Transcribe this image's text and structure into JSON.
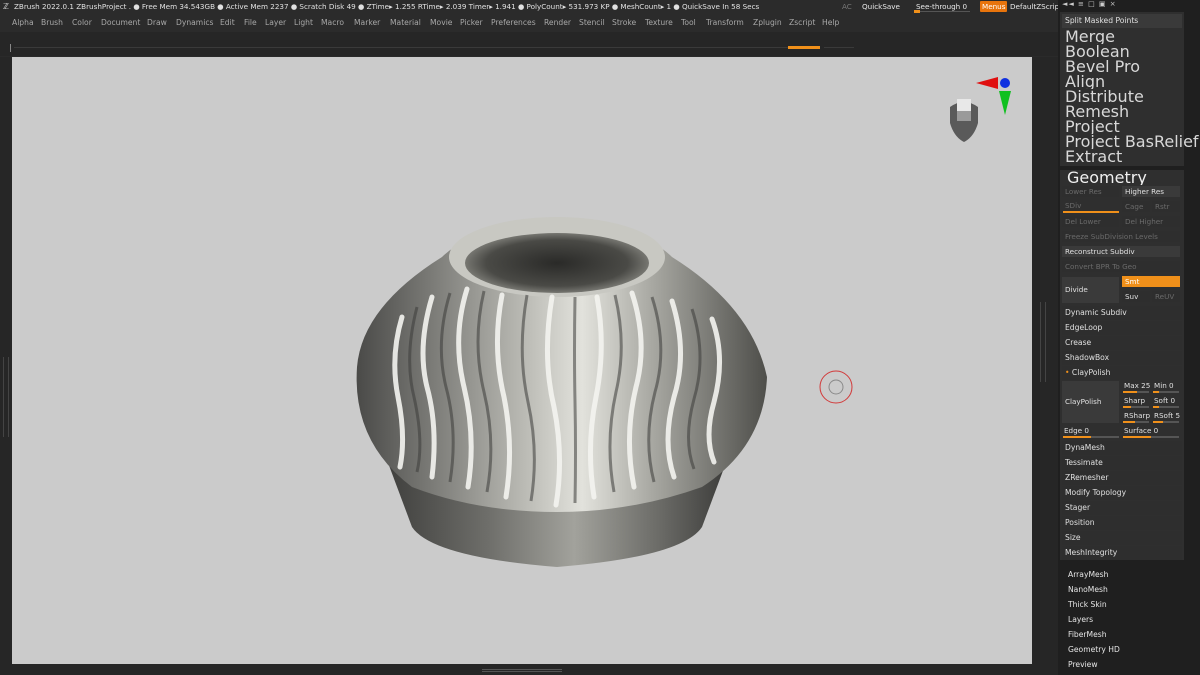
{
  "title": {
    "info": "ZBrush 2022.0.1    ZBrushProject    . ● Free Mem 34.543GB ● Active Mem 2237 ● Scratch Disk 49 ●  ZTime▸ 1.255 RTime▸ 2.039 Timer▸ 1.941 ● PolyCount▸ 531.973 KP  ● MeshCount▸ 1   ● QuickSave In 58 Secs",
    "ac": "AC",
    "quicksave": "QuickSave",
    "see_through": "See-through  0",
    "menus": "Menus",
    "default_zscript": "DefaultZScript",
    "top_icons": "◄◄  ≡  □  ▣  ×"
  },
  "menubar": [
    "Alpha",
    "Brush",
    "Color",
    "Document",
    "Draw",
    "Dynamics",
    "Edit",
    "File",
    "Layer",
    "Light",
    "Macro",
    "Marker",
    "Material",
    "Movie",
    "Picker",
    "Preferences",
    "Render",
    "Stencil",
    "Stroke",
    "Texture",
    "Tool",
    "Transform",
    "Zplugin",
    "Zscript",
    "Help"
  ],
  "subtool": {
    "items": [
      "Split Masked Points",
      "Merge",
      "Boolean",
      "Bevel Pro",
      "Align",
      "Distribute",
      "Remesh",
      "Project",
      "Project BasRelief",
      "Extract"
    ]
  },
  "geometry": {
    "header": "Geometry",
    "lower_res": "Lower Res",
    "higher_res": "Higher Res",
    "sdiv": "SDiv",
    "cage": "Cage",
    "rstr": "Rstr",
    "del_lower": "Del Lower",
    "del_higher": "Del Higher",
    "freeze": "Freeze SubDivision Levels",
    "reconstruct": "Reconstruct Subdiv",
    "convert_bpr": "Convert BPR To Geo",
    "divide": "Divide",
    "smt": "Smt",
    "suv": "Suv",
    "reuv": "ReUV",
    "dynamic_subdiv": "Dynamic Subdiv",
    "edgeloop": "EdgeLoop",
    "crease": "Crease",
    "shadowbox": "ShadowBox",
    "claypolish_header": "ClayPolish",
    "claypolish_btn": "ClayPolish",
    "max": "Max 25",
    "min": "Min 0",
    "sharp": "Sharp",
    "soft": "Soft 0",
    "rsharp": "RSharp",
    "rsoft": "RSoft 5",
    "edge": "Edge 0",
    "surface": "Surface 0",
    "after": [
      "DynaMesh",
      "Tessimate",
      "ZRemesher",
      "Modify Topology",
      "Stager",
      "Position",
      "Size",
      "MeshIntegrity"
    ]
  },
  "tool_sections": [
    "ArrayMesh",
    "NanoMesh",
    "Thick Skin",
    "Layers",
    "FiberMesh",
    "Geometry HD",
    "Preview"
  ],
  "colors": {
    "accent": "#f0901a",
    "canvas": "#cbcbcb",
    "brush_ring": "#d23a3a"
  }
}
